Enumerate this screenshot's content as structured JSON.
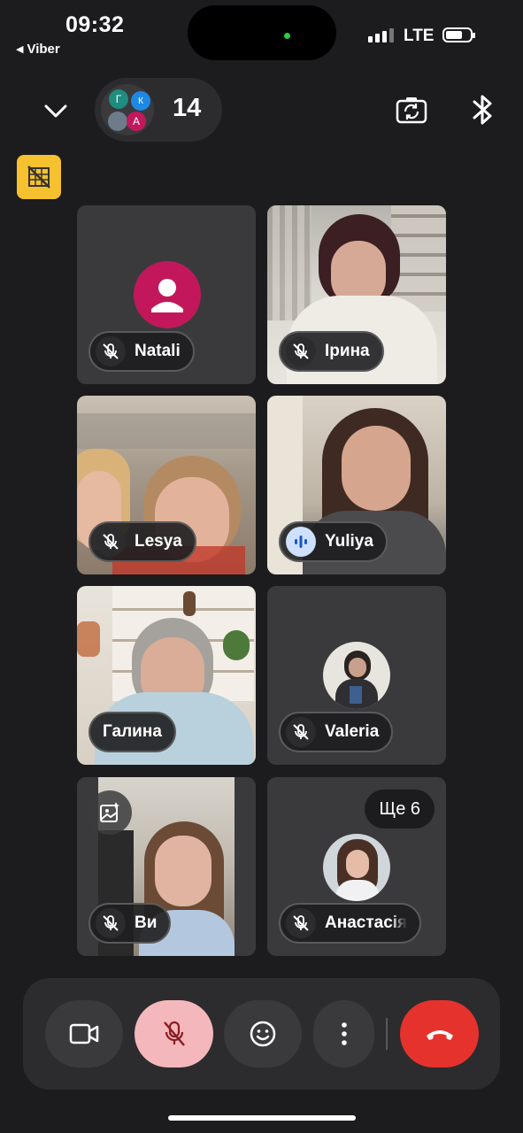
{
  "status_bar": {
    "time": "09:32",
    "back_app": "Viber",
    "network": "LTE"
  },
  "call_header": {
    "participant_count": "14",
    "cluster_initials": [
      "Г",
      "К",
      "А"
    ]
  },
  "tiles": [
    {
      "name": "Natali",
      "muted": true,
      "video": false
    },
    {
      "name": "Ірина",
      "muted": true,
      "video": true
    },
    {
      "name": "Lesya",
      "muted": true,
      "video": true
    },
    {
      "name": "Yuliya",
      "muted": false,
      "speaking": true,
      "video": true
    },
    {
      "name": "Галина",
      "muted": false,
      "video": true
    },
    {
      "name": "Valeria",
      "muted": true,
      "video": false
    },
    {
      "name": "Ви",
      "muted": true,
      "video": true
    },
    {
      "name": "Анастасія",
      "muted": true,
      "video": false
    }
  ],
  "more_participants_label": "Ще 6",
  "controls": [
    {
      "name": "camera"
    },
    {
      "name": "microphone-muted"
    },
    {
      "name": "reactions"
    },
    {
      "name": "more-options"
    },
    {
      "name": "end-call"
    }
  ],
  "colors": {
    "background": "#1c1c1e",
    "tile": "#3a3a3c",
    "avatar_magenta": "#c2185b",
    "end_call": "#e5322d",
    "mic_muted": "#f4b8bc",
    "no_video_badge": "#f6c12e"
  }
}
